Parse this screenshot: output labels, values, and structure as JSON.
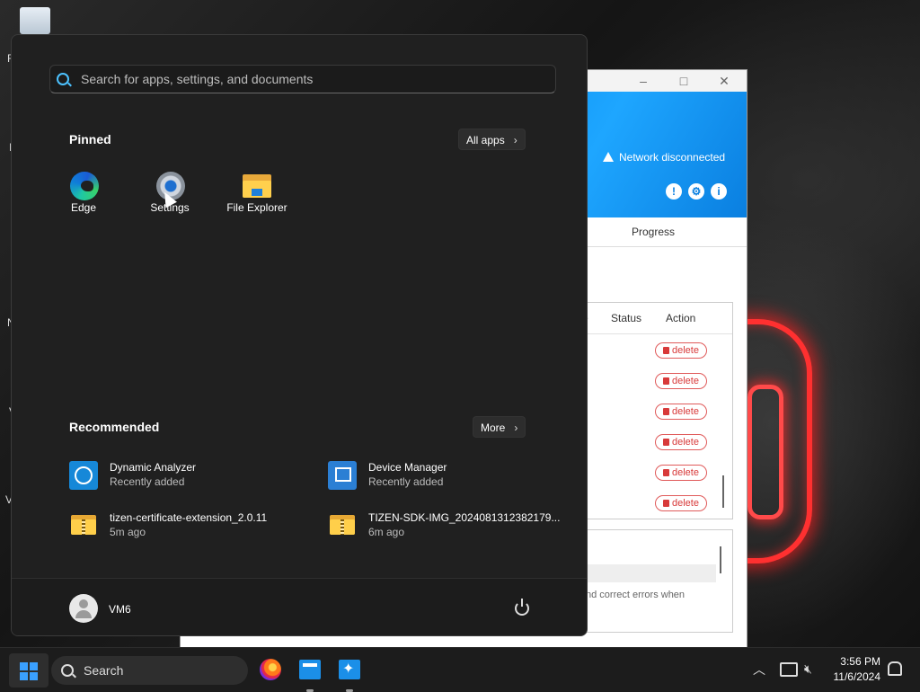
{
  "start_menu": {
    "search_placeholder": "Search for apps, settings, and documents",
    "pinned_title": "Pinned",
    "all_apps_label": "All apps",
    "pinned": [
      {
        "label": "Edge",
        "icon": "edge-icon"
      },
      {
        "label": "Settings",
        "icon": "settings-gear-icon"
      },
      {
        "label": "File Explorer",
        "icon": "file-explorer-folder-icon"
      }
    ],
    "recommended_title": "Recommended",
    "more_label": "More",
    "recommended": [
      {
        "name": "Dynamic Analyzer",
        "sub": "Recently added",
        "icon": "dynamic-analyzer-icon"
      },
      {
        "name": "Device Manager",
        "sub": "Recently added",
        "icon": "device-manager-icon"
      },
      {
        "name": "tizen-certificate-extension_2.0.11",
        "sub": "5m ago",
        "icon": "zip-folder-icon"
      },
      {
        "name": "TIZEN-SDK-IMG_2024081312382179...",
        "sub": "6m ago",
        "icon": "zip-folder-icon"
      }
    ],
    "user_name": "VM6"
  },
  "background_window": {
    "network_status": "Network disconnected",
    "tab_label": "Progress",
    "table_headers": [
      "e",
      "Status",
      "Action"
    ],
    "delete_label": "delete",
    "rows": 6,
    "log_text": "nd correct errors when",
    "banner_color": "#0a8ff0",
    "delete_color": "#d83a3a"
  },
  "taskbar": {
    "search_label": "Search",
    "time": "3:56 PM",
    "date": "11/6/2024",
    "accent": "#3aa0ff"
  }
}
